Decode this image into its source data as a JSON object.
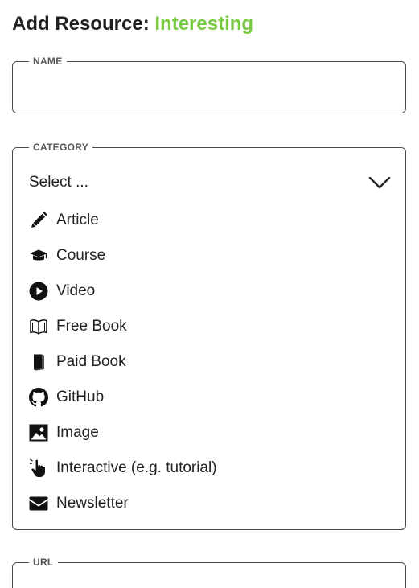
{
  "heading": {
    "prefix": "Add Resource:",
    "accent": "Interesting",
    "accent_color": "#7ac943"
  },
  "name_field": {
    "legend": "NAME",
    "value": ""
  },
  "category_field": {
    "legend": "CATEGORY",
    "placeholder": "Select ...",
    "options": [
      {
        "label": "Article",
        "icon": "pencil-icon"
      },
      {
        "label": "Course",
        "icon": "graduation-cap-icon"
      },
      {
        "label": "Video",
        "icon": "play-circle-icon"
      },
      {
        "label": "Free Book",
        "icon": "open-book-icon"
      },
      {
        "label": "Paid Book",
        "icon": "book-icon"
      },
      {
        "label": "GitHub",
        "icon": "github-icon"
      },
      {
        "label": "Image",
        "icon": "image-icon"
      },
      {
        "label": "Interactive (e.g. tutorial)",
        "icon": "hand-pointer-icon"
      },
      {
        "label": "Newsletter",
        "icon": "envelope-icon"
      }
    ]
  },
  "url_field": {
    "legend": "URL"
  }
}
